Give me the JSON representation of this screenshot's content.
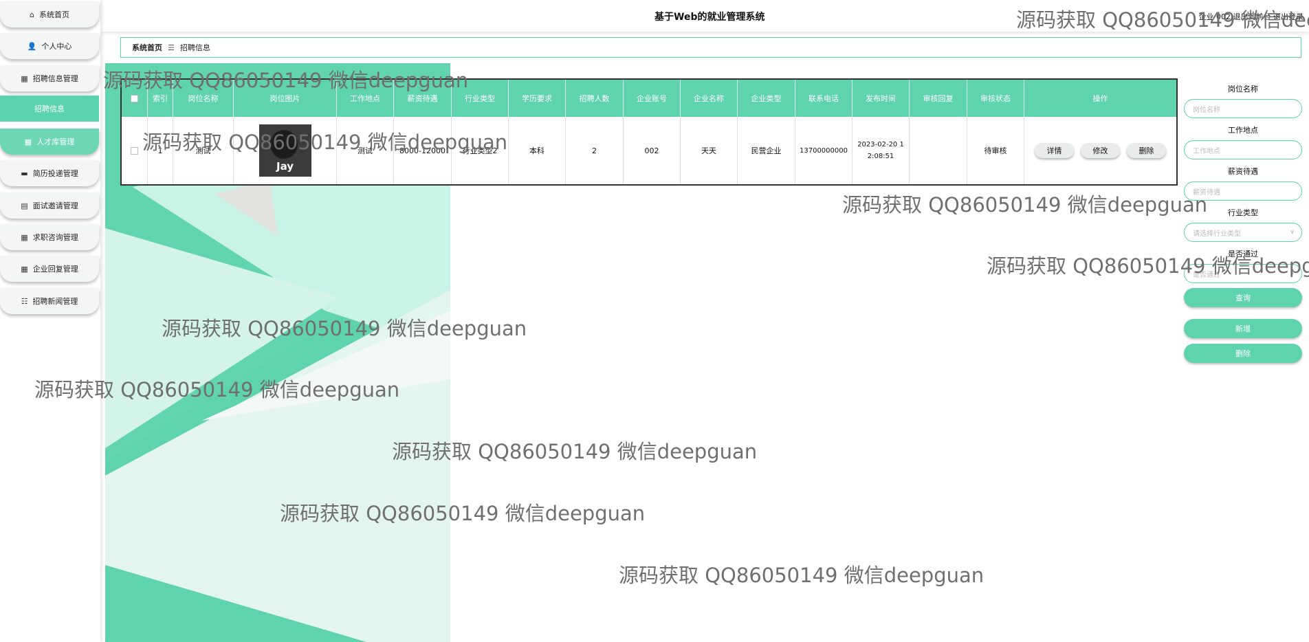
{
  "sidebar": {
    "items": [
      {
        "icon": "home-icon",
        "glyph": "⌂",
        "label": "系统首页"
      },
      {
        "icon": "user-icon",
        "glyph": "👤",
        "label": "个人中心"
      },
      {
        "icon": "grid-icon",
        "glyph": "▦",
        "label": "招聘信息管理"
      },
      {
        "icon": "",
        "glyph": "",
        "label": "招聘信息"
      },
      {
        "icon": "grid-icon",
        "glyph": "▦",
        "label": "人才库管理"
      },
      {
        "icon": "monitor-icon",
        "glyph": "▬",
        "label": "简历投递管理"
      },
      {
        "icon": "document-icon",
        "glyph": "▤",
        "label": "面试邀请管理"
      },
      {
        "icon": "grid-icon",
        "glyph": "▦",
        "label": "求职咨询管理"
      },
      {
        "icon": "grid-icon",
        "glyph": "▦",
        "label": "企业回复管理"
      },
      {
        "icon": "list-icon",
        "glyph": "☷",
        "label": "招聘新闻管理"
      }
    ]
  },
  "header": {
    "title": "基于Web的就业管理系统",
    "user_info": "企业 002  退出到前台  退出登录"
  },
  "breadcrumb": {
    "home": "系统首页",
    "sep": "☰",
    "current": "招聘信息"
  },
  "table": {
    "headers": [
      "",
      "索引",
      "岗位名称",
      "岗位图片",
      "工作地点",
      "薪资待遇",
      "行业类型",
      "学历要求",
      "招聘人数",
      "企业账号",
      "企业名称",
      "企业类型",
      "联系电话",
      "发布时间",
      "审核回复",
      "审核状态",
      "操作"
    ],
    "row": {
      "index": "1",
      "job_name": "测试",
      "image_text": "Jay",
      "location": "测试",
      "salary": "8000-12000",
      "industry": "行业类型2",
      "education": "本科",
      "count": "2",
      "account": "002",
      "company": "天天",
      "company_type": "民营企业",
      "phone": "13700000000",
      "publish_time": "2023-02-20 12:08:51",
      "review_reply": "",
      "review_status": "待审核"
    },
    "actions": {
      "detail": "详情",
      "edit": "修改",
      "delete": "删除"
    }
  },
  "search": {
    "job_label": "岗位名称",
    "job_placeholder": "岗位名称",
    "location_label": "工作地点",
    "location_placeholder": "工作地点",
    "salary_label": "薪资待遇",
    "salary_placeholder": "薪资待遇",
    "industry_label": "行业类型",
    "industry_placeholder": "请选择行业类型",
    "pass_label": "是否通过",
    "pass_placeholder": "是否通过",
    "query_btn": "查询",
    "add_btn": "新增",
    "delete_btn": "删除"
  },
  "watermark": "源码获取 QQ86050149 微信deepguan",
  "colors": {
    "accent": "#5ed3ae"
  }
}
